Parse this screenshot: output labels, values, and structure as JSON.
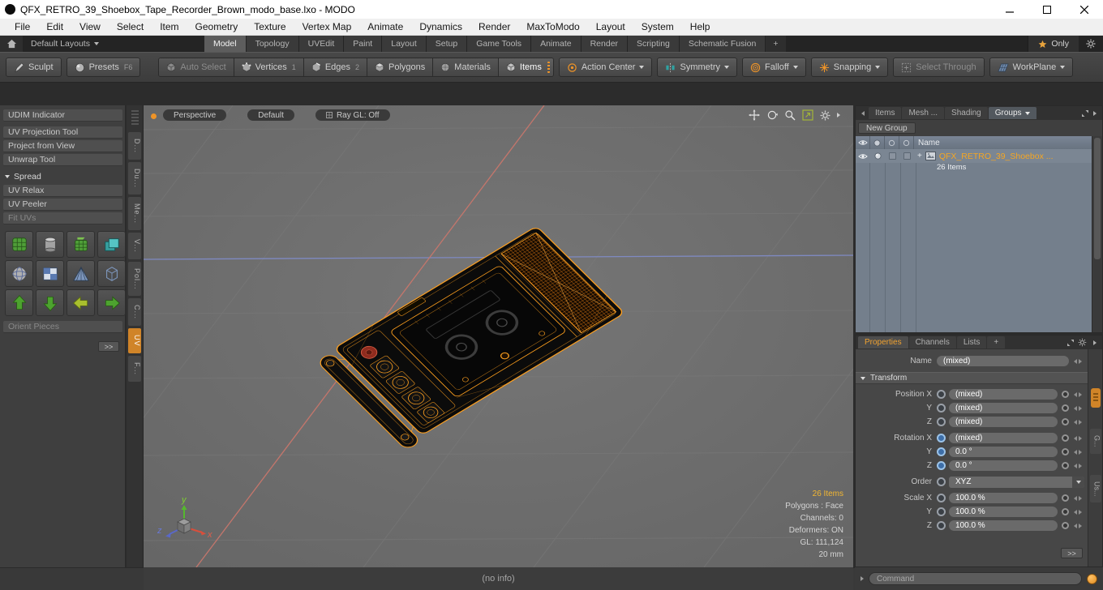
{
  "colors": {
    "accent_orange": "#ef9428",
    "wireframe_orange": "#ffa01e",
    "axis_x_red": "#e05d4a",
    "axis_y_green": "#7ed32f",
    "axis_z_blue": "#6a79d8",
    "selected_item_orange": "#f5a623"
  },
  "titlebar": {
    "title": "QFX_RETRO_39_Shoebox_Tape_Recorder_Brown_modo_base.lxo - MODO"
  },
  "menubar": {
    "items": [
      "File",
      "Edit",
      "View",
      "Select",
      "Item",
      "Geometry",
      "Texture",
      "Vertex Map",
      "Animate",
      "Dynamics",
      "Render",
      "MaxToModo",
      "Layout",
      "System",
      "Help"
    ]
  },
  "layoutbar": {
    "default_layouts": "Default Layouts",
    "tabs": [
      "Model",
      "Topology",
      "UVEdit",
      "Paint",
      "Layout",
      "Setup",
      "Game Tools",
      "Animate",
      "Render",
      "Scripting",
      "Schematic Fusion"
    ],
    "add_tab": "+",
    "only_label": "Only"
  },
  "toolbar": {
    "sculpt": "Sculpt",
    "presets": "Presets",
    "presets_shortcut": "F6",
    "auto_select": "Auto Select",
    "vertices": "Vertices",
    "vertices_shortcut": "1",
    "edges": "Edges",
    "edges_shortcut": "2",
    "polygons": "Polygons",
    "materials": "Materials",
    "items": "Items",
    "action_center": "Action Center",
    "symmetry": "Symmetry",
    "falloff": "Falloff",
    "snapping": "Snapping",
    "select_through": "Select Through",
    "workplane": "WorkPlane"
  },
  "left_panel": {
    "tools": [
      "UDIM Indicator",
      "UV Projection Tool",
      "Project from View",
      "Unwrap Tool"
    ],
    "spread_header": "Spread",
    "spread_tools": [
      "UV Relax",
      "UV Peeler",
      "Fit UVs"
    ],
    "orient_pieces": "Orient Pieces",
    "more_label": ">>",
    "vertical_tabs": [
      "D...",
      "Du...",
      "Me...",
      "V...",
      "Pol...",
      "C...",
      "UV",
      "F..."
    ]
  },
  "viewport": {
    "view_button": "Perspective",
    "shading_button": "Default",
    "raygl_button": "Ray GL: Off",
    "stats": {
      "items": "26 Items",
      "polygons": "Polygons : Face",
      "channels": "Channels: 0",
      "deformers": "Deformers: ON",
      "gl": "GL: 111,124",
      "grid_size": "20 mm"
    },
    "axis_labels": {
      "x": "x",
      "y": "y",
      "z": "z"
    }
  },
  "item_list": {
    "tabs": [
      "Items",
      "Mesh ...",
      "Shading",
      "Groups"
    ],
    "new_group": "New Group",
    "columns": {
      "name": "Name"
    },
    "row": {
      "expand": "+",
      "name": "QFX_RETRO_39_Shoebox ...",
      "count": "26 Items"
    }
  },
  "properties": {
    "tabs": [
      "Properties",
      "Channels",
      "Lists"
    ],
    "add_tab": "+",
    "name_label": "Name",
    "name_value": "(mixed)",
    "transform_header": "Transform",
    "position": {
      "x_label": "Position X",
      "x": "(mixed)",
      "y_label": "Y",
      "y": "(mixed)",
      "z_label": "Z",
      "z": "(mixed)"
    },
    "rotation": {
      "x_label": "Rotation X",
      "x": "(mixed)",
      "y_label": "Y",
      "y": "0.0 °",
      "z_label": "Z",
      "z": "0.0 °"
    },
    "order_label": "Order",
    "order_value": "XYZ",
    "scale": {
      "x_label": "Scale X",
      "x": "100.0 %",
      "y_label": "Y",
      "y": "100.0 %",
      "z_label": "Z",
      "z": "100.0 %"
    },
    "more_label": ">>",
    "side_tabs": [
      "G...",
      "Us..."
    ]
  },
  "statusbar": {
    "info": "(no info)"
  },
  "command": {
    "placeholder": "Command"
  }
}
